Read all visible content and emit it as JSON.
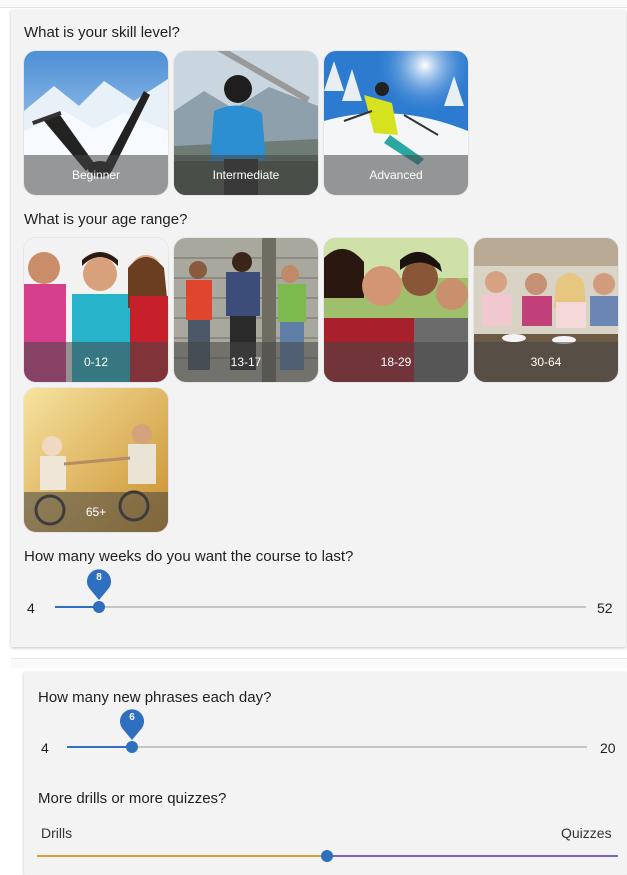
{
  "skill": {
    "question": "What is your skill level?",
    "options": [
      {
        "label": "Beginner"
      },
      {
        "label": "Intermediate"
      },
      {
        "label": "Advanced"
      }
    ]
  },
  "age": {
    "question": "What is your age range?",
    "options": [
      {
        "label": "0-12"
      },
      {
        "label": "13-17"
      },
      {
        "label": "18-29"
      },
      {
        "label": "30-64"
      },
      {
        "label": "65+"
      }
    ]
  },
  "weeks": {
    "question": "How many weeks do you want the course to last?",
    "min": "4",
    "max": "52",
    "value": "8"
  },
  "phrases": {
    "question": "How many new phrases each day?",
    "min": "4",
    "max": "20",
    "value": "6"
  },
  "drills": {
    "question": "More drills or more quizzes?",
    "left_label": "Drills",
    "right_label": "Quizzes",
    "value_fraction": 0.5
  },
  "colors": {
    "accent_blue": "#2f6fbf",
    "drills_orange": "#e39a3b",
    "quizzes_purple": "#7d63b8",
    "track_gray": "#c4c4c4"
  }
}
